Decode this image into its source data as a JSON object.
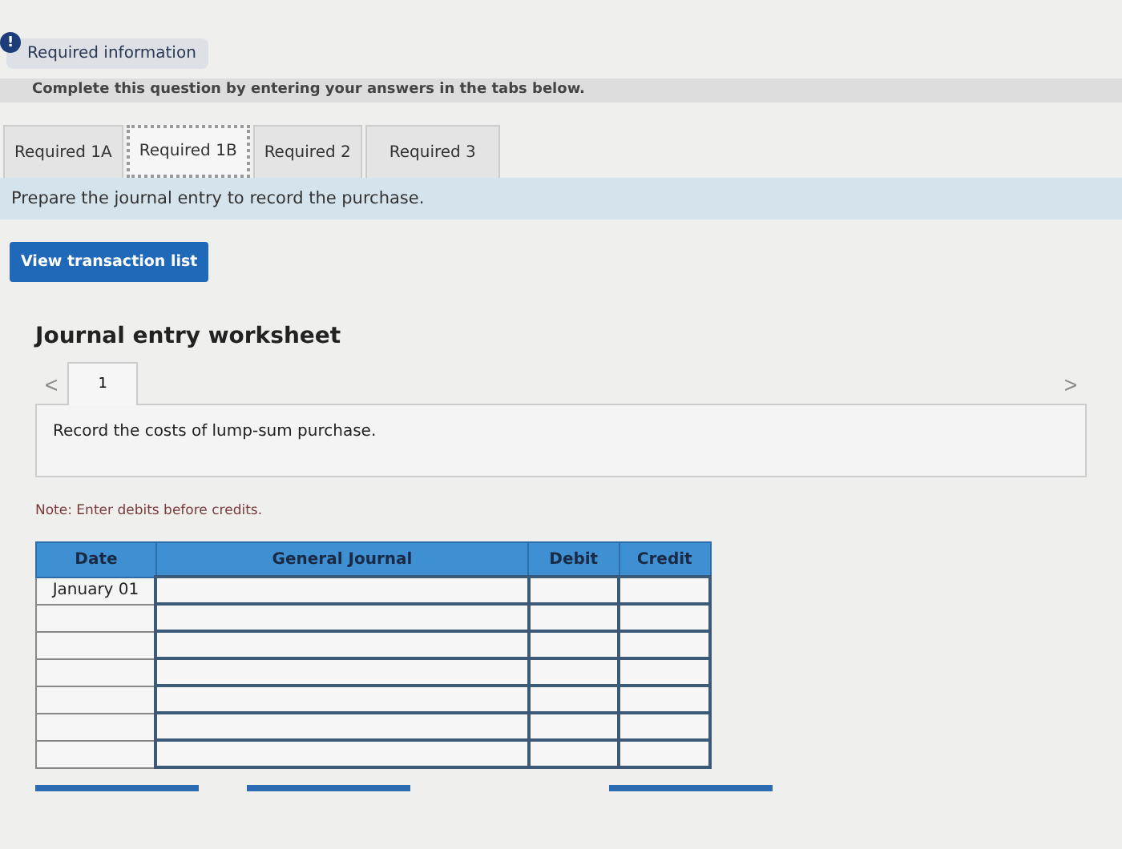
{
  "notice": {
    "icon": "!",
    "label": "Required information"
  },
  "instruction": "Complete this question by entering your answers in the tabs below.",
  "tabs": [
    {
      "label": "Required 1A",
      "selected": false
    },
    {
      "label": "Required 1B",
      "selected": true
    },
    {
      "label": "Required 2",
      "selected": false
    },
    {
      "label": "Required 3",
      "selected": false
    }
  ],
  "prompt": "Prepare the journal entry to record the purchase.",
  "view_button": "View transaction list",
  "worksheet": {
    "title": "Journal entry worksheet",
    "prev": "<",
    "next": ">",
    "pages": [
      {
        "label": "1"
      }
    ],
    "description": "Record the costs of lump-sum purchase."
  },
  "note": "Note: Enter debits before credits.",
  "table": {
    "columns": [
      "Date",
      "General Journal",
      "Debit",
      "Credit"
    ],
    "rows": [
      {
        "date": "January 01"
      },
      {
        "date": ""
      },
      {
        "date": ""
      },
      {
        "date": ""
      },
      {
        "date": ""
      },
      {
        "date": ""
      },
      {
        "date": ""
      }
    ]
  }
}
